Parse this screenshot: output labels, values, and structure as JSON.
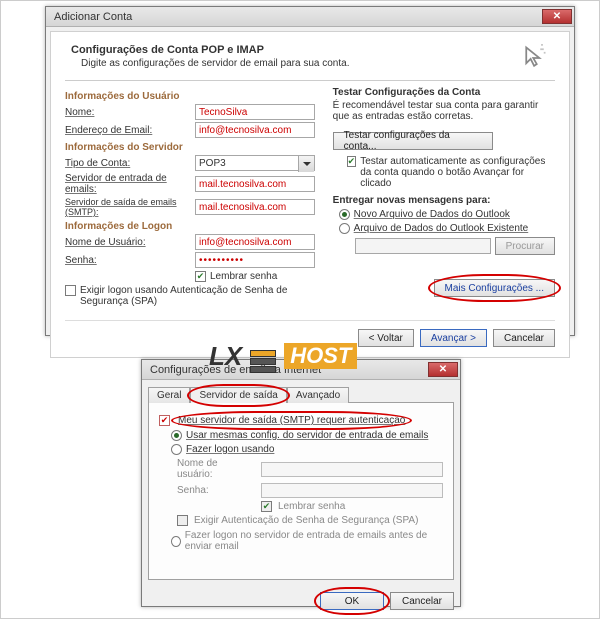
{
  "win1": {
    "title": "Adicionar Conta",
    "header_title": "Configurações de Conta POP e IMAP",
    "header_sub": "Digite as configurações de servidor de email para sua conta.",
    "sec_user": "Informações do Usuário",
    "lbl_name": "Nome:",
    "val_name": "TecnoSilva",
    "lbl_email": "Endereço de Email:",
    "val_email": "info@tecnosilva.com",
    "sec_server": "Informações do Servidor",
    "lbl_type": "Tipo de Conta:",
    "val_type": "POP3",
    "lbl_in": "Servidor de entrada de emails:",
    "val_in": "mail.tecnosilva.com",
    "lbl_out": "Servidor de saída de emails (SMTP):",
    "val_out": "mail.tecnosilva.com",
    "sec_logon": "Informações de Logon",
    "lbl_user": "Nome de Usuário:",
    "val_user": "info@tecnosilva.com",
    "lbl_pass": "Senha:",
    "val_pass": "••••••••••",
    "remember": "Lembrar senha",
    "spa": "Exigir logon usando Autenticação de Senha de Segurança (SPA)",
    "test_title": "Testar Configurações da Conta",
    "test_desc": "É recomendável testar sua conta para garantir que as entradas estão corretas.",
    "test_btn": "Testar configurações da conta...",
    "auto_test": "Testar automaticamente as configurações da conta quando o botão Avançar for clicado",
    "deliver": "Entregar novas mensagens para:",
    "r1": "Novo Arquivo de Dados do Outlook",
    "r2": "Arquivo de Dados do Outlook Existente",
    "browse": "Procurar",
    "more": "Mais Configurações ...",
    "back": "< Voltar",
    "next": "Avançar >",
    "cancel": "Cancelar"
  },
  "logo": {
    "lx": "LX",
    "host": "HOST"
  },
  "win2": {
    "title": "Configurações de email na Internet",
    "tab1": "Geral",
    "tab2": "Servidor de saída",
    "tab3": "Avançado",
    "chk_main": "Meu servidor de saída (SMTP) requer autenticação",
    "r1": "Usar mesmas config. do servidor de entrada de emails",
    "r2": "Fazer logon usando",
    "lbl_user": "Nome de usuário:",
    "lbl_pass": "Senha:",
    "remember": "Lembrar senha",
    "spa": "Exigir Autenticação de Senha de Segurança (SPA)",
    "r3": "Fazer logon no servidor de entrada de emails antes de enviar email",
    "ok": "OK",
    "cancel": "Cancelar"
  }
}
